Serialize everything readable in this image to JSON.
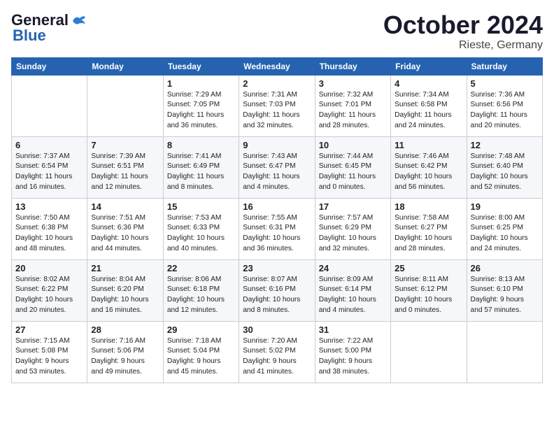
{
  "header": {
    "logo_general": "General",
    "logo_blue": "Blue",
    "month": "October 2024",
    "location": "Rieste, Germany"
  },
  "weekdays": [
    "Sunday",
    "Monday",
    "Tuesday",
    "Wednesday",
    "Thursday",
    "Friday",
    "Saturday"
  ],
  "weeks": [
    [
      {
        "day": null,
        "info": null
      },
      {
        "day": null,
        "info": null
      },
      {
        "day": "1",
        "info": "Sunrise: 7:29 AM\nSunset: 7:05 PM\nDaylight: 11 hours\nand 36 minutes."
      },
      {
        "day": "2",
        "info": "Sunrise: 7:31 AM\nSunset: 7:03 PM\nDaylight: 11 hours\nand 32 minutes."
      },
      {
        "day": "3",
        "info": "Sunrise: 7:32 AM\nSunset: 7:01 PM\nDaylight: 11 hours\nand 28 minutes."
      },
      {
        "day": "4",
        "info": "Sunrise: 7:34 AM\nSunset: 6:58 PM\nDaylight: 11 hours\nand 24 minutes."
      },
      {
        "day": "5",
        "info": "Sunrise: 7:36 AM\nSunset: 6:56 PM\nDaylight: 11 hours\nand 20 minutes."
      }
    ],
    [
      {
        "day": "6",
        "info": "Sunrise: 7:37 AM\nSunset: 6:54 PM\nDaylight: 11 hours\nand 16 minutes."
      },
      {
        "day": "7",
        "info": "Sunrise: 7:39 AM\nSunset: 6:51 PM\nDaylight: 11 hours\nand 12 minutes."
      },
      {
        "day": "8",
        "info": "Sunrise: 7:41 AM\nSunset: 6:49 PM\nDaylight: 11 hours\nand 8 minutes."
      },
      {
        "day": "9",
        "info": "Sunrise: 7:43 AM\nSunset: 6:47 PM\nDaylight: 11 hours\nand 4 minutes."
      },
      {
        "day": "10",
        "info": "Sunrise: 7:44 AM\nSunset: 6:45 PM\nDaylight: 11 hours\nand 0 minutes."
      },
      {
        "day": "11",
        "info": "Sunrise: 7:46 AM\nSunset: 6:42 PM\nDaylight: 10 hours\nand 56 minutes."
      },
      {
        "day": "12",
        "info": "Sunrise: 7:48 AM\nSunset: 6:40 PM\nDaylight: 10 hours\nand 52 minutes."
      }
    ],
    [
      {
        "day": "13",
        "info": "Sunrise: 7:50 AM\nSunset: 6:38 PM\nDaylight: 10 hours\nand 48 minutes."
      },
      {
        "day": "14",
        "info": "Sunrise: 7:51 AM\nSunset: 6:36 PM\nDaylight: 10 hours\nand 44 minutes."
      },
      {
        "day": "15",
        "info": "Sunrise: 7:53 AM\nSunset: 6:33 PM\nDaylight: 10 hours\nand 40 minutes."
      },
      {
        "day": "16",
        "info": "Sunrise: 7:55 AM\nSunset: 6:31 PM\nDaylight: 10 hours\nand 36 minutes."
      },
      {
        "day": "17",
        "info": "Sunrise: 7:57 AM\nSunset: 6:29 PM\nDaylight: 10 hours\nand 32 minutes."
      },
      {
        "day": "18",
        "info": "Sunrise: 7:58 AM\nSunset: 6:27 PM\nDaylight: 10 hours\nand 28 minutes."
      },
      {
        "day": "19",
        "info": "Sunrise: 8:00 AM\nSunset: 6:25 PM\nDaylight: 10 hours\nand 24 minutes."
      }
    ],
    [
      {
        "day": "20",
        "info": "Sunrise: 8:02 AM\nSunset: 6:22 PM\nDaylight: 10 hours\nand 20 minutes."
      },
      {
        "day": "21",
        "info": "Sunrise: 8:04 AM\nSunset: 6:20 PM\nDaylight: 10 hours\nand 16 minutes."
      },
      {
        "day": "22",
        "info": "Sunrise: 8:06 AM\nSunset: 6:18 PM\nDaylight: 10 hours\nand 12 minutes."
      },
      {
        "day": "23",
        "info": "Sunrise: 8:07 AM\nSunset: 6:16 PM\nDaylight: 10 hours\nand 8 minutes."
      },
      {
        "day": "24",
        "info": "Sunrise: 8:09 AM\nSunset: 6:14 PM\nDaylight: 10 hours\nand 4 minutes."
      },
      {
        "day": "25",
        "info": "Sunrise: 8:11 AM\nSunset: 6:12 PM\nDaylight: 10 hours\nand 0 minutes."
      },
      {
        "day": "26",
        "info": "Sunrise: 8:13 AM\nSunset: 6:10 PM\nDaylight: 9 hours\nand 57 minutes."
      }
    ],
    [
      {
        "day": "27",
        "info": "Sunrise: 7:15 AM\nSunset: 5:08 PM\nDaylight: 9 hours\nand 53 minutes."
      },
      {
        "day": "28",
        "info": "Sunrise: 7:16 AM\nSunset: 5:06 PM\nDaylight: 9 hours\nand 49 minutes."
      },
      {
        "day": "29",
        "info": "Sunrise: 7:18 AM\nSunset: 5:04 PM\nDaylight: 9 hours\nand 45 minutes."
      },
      {
        "day": "30",
        "info": "Sunrise: 7:20 AM\nSunset: 5:02 PM\nDaylight: 9 hours\nand 41 minutes."
      },
      {
        "day": "31",
        "info": "Sunrise: 7:22 AM\nSunset: 5:00 PM\nDaylight: 9 hours\nand 38 minutes."
      },
      {
        "day": null,
        "info": null
      },
      {
        "day": null,
        "info": null
      }
    ]
  ]
}
